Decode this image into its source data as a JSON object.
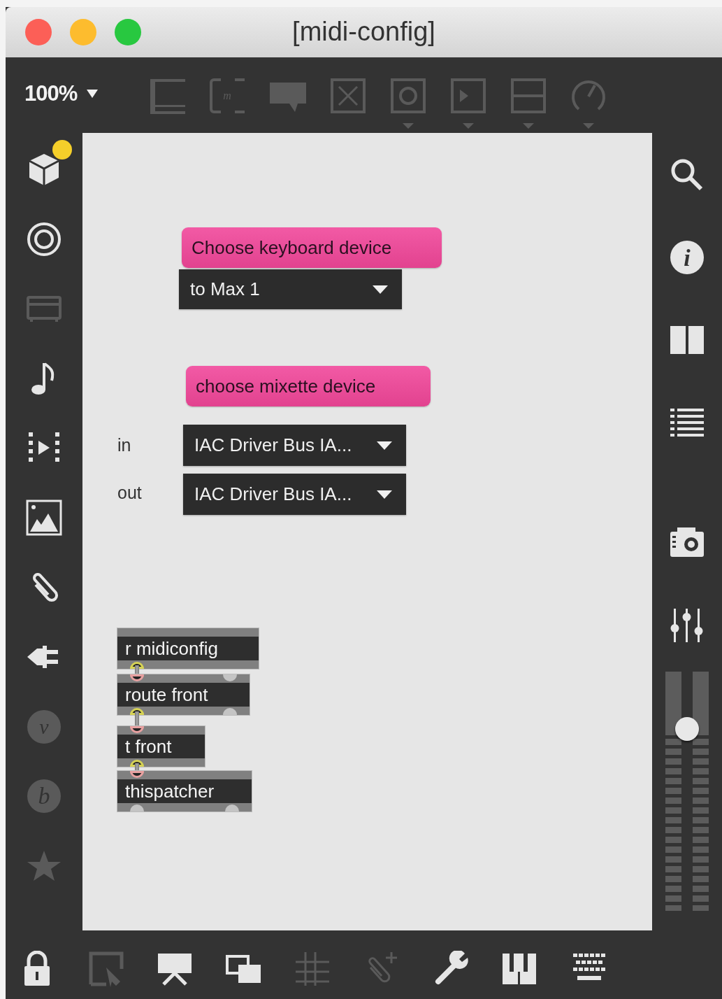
{
  "window": {
    "title": "[midi-config]"
  },
  "toolbar": {
    "zoom": "100%",
    "tools": [
      {
        "disabled": true
      },
      {
        "disabled": true,
        "glyph": "m"
      },
      {
        "disabled": true
      },
      {
        "disabled": true
      },
      {
        "disabled": true
      },
      {
        "disabled": true
      },
      {
        "disabled": true
      },
      {
        "disabled": true
      }
    ]
  },
  "left_sidebar": {
    "items": [
      {
        "disabled": false,
        "notification": true
      },
      {
        "disabled": false,
        "notification": false
      },
      {
        "disabled": true,
        "notification": false
      },
      {
        "disabled": false,
        "notification": false
      },
      {
        "disabled": false,
        "notification": false
      },
      {
        "disabled": false,
        "notification": false
      },
      {
        "disabled": false,
        "notification": false
      },
      {
        "disabled": false,
        "notification": false
      },
      {
        "disabled": true,
        "notification": false,
        "glyph": "v"
      },
      {
        "disabled": true,
        "notification": false,
        "glyph": "b"
      },
      {
        "disabled": true,
        "notification": false
      }
    ]
  },
  "patch": {
    "objects": [
      {
        "kind": "message",
        "text": "Choose keyboard device"
      },
      {
        "kind": "menu",
        "text": "to Max 1"
      },
      {
        "kind": "message",
        "text": "choose mixette device"
      },
      {
        "kind": "comment",
        "text": "in"
      },
      {
        "kind": "menu",
        "text": "IAC Driver Bus IA..."
      },
      {
        "kind": "comment",
        "text": "out"
      },
      {
        "kind": "menu",
        "text": "IAC Driver Bus IA..."
      },
      {
        "kind": "object",
        "text": "r midiconfig",
        "outlets": [
          {
            "connected": true
          }
        ]
      },
      {
        "kind": "object",
        "text": "route front",
        "inlets": [
          {
            "connected": true
          },
          {
            "connected": false
          }
        ],
        "outlets": [
          {
            "connected": true
          },
          {
            "connected": false
          }
        ]
      },
      {
        "kind": "object",
        "text": "t front",
        "inlets": [
          {
            "connected": true
          }
        ],
        "outlets": [
          {
            "connected": true
          }
        ]
      },
      {
        "kind": "object",
        "text": "thispatcher",
        "inlets": [
          {
            "connected": true
          }
        ],
        "outlets": [
          {
            "connected": false
          },
          {
            "connected": false
          }
        ]
      }
    ]
  },
  "right_sidebar": {
    "items": [
      {
        "disabled": false
      },
      {
        "disabled": false,
        "glyph": "i"
      },
      {
        "disabled": false
      },
      {
        "disabled": false
      },
      {
        "disabled": false
      },
      {
        "disabled": false
      }
    ],
    "volume": {
      "level": 0.76
    }
  },
  "bottom_bar": {
    "tools": [
      {
        "disabled": false
      },
      {
        "disabled": true
      },
      {
        "disabled": false
      },
      {
        "disabled": false
      },
      {
        "disabled": true
      },
      {
        "disabled": true
      },
      {
        "disabled": false
      },
      {
        "disabled": false
      },
      {
        "disabled": false
      }
    ]
  }
}
